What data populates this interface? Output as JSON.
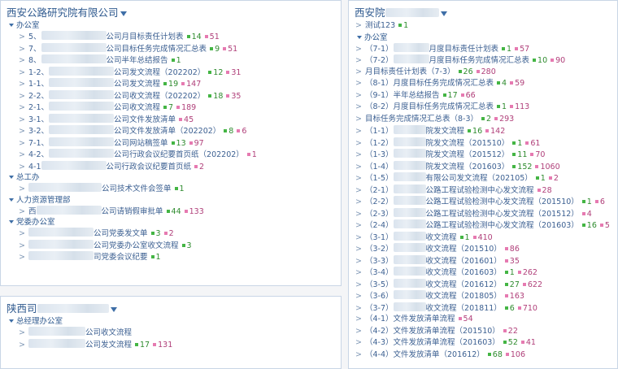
{
  "panels": [
    {
      "title": "西安公路研究院有限公司",
      "sections": [
        {
          "label": "办公室",
          "items": [
            {
              "prefix": "5、",
              "suffix": "公司月目标责任计划表",
              "g": "14",
              "r": "51"
            },
            {
              "prefix": "7、",
              "suffix": "公司目标任务完成情况汇总表",
              "g": "9",
              "r": "51"
            },
            {
              "prefix": "8、",
              "suffix": "公司半年总结报告",
              "g": "1",
              "r": ""
            },
            {
              "prefix": "1-2、",
              "suffix": "公司发文流程（202202）",
              "g": "12",
              "r": "31"
            },
            {
              "prefix": "1-1、",
              "suffix": "公司发文流程",
              "g": "19",
              "r": "147"
            },
            {
              "prefix": "2-2、",
              "suffix": "公司收文流程（202202）",
              "g": "18",
              "r": "35"
            },
            {
              "prefix": "2-1、",
              "suffix": "公司收文流程",
              "g": "7",
              "r": "189"
            },
            {
              "prefix": "3-1、",
              "suffix": "公司文件发放清单",
              "g": "",
              "r": "45"
            },
            {
              "prefix": "3-2、",
              "suffix": "公司文件发放清单（202202）",
              "g": "8",
              "r": "6"
            },
            {
              "prefix": "7-1、",
              "suffix": "公司网站稿签单",
              "g": "13",
              "r": "97"
            },
            {
              "prefix": "4-2、",
              "suffix": "公司行政会议纪要首页纸（202202）",
              "g": "",
              "r": "1"
            },
            {
              "prefix": "4-1",
              "suffix": "公司行政会议纪要首页纸",
              "g": "",
              "r": "2"
            }
          ]
        },
        {
          "label": "总工办",
          "items": [
            {
              "prefix": "",
              "suffix": "公司技术文件会签单",
              "g": "1",
              "r": ""
            }
          ]
        },
        {
          "label": "人力资源管理部",
          "items": [
            {
              "prefix": "西",
              "suffix": "公司请销假审批单",
              "g": "44",
              "r": "133"
            }
          ]
        },
        {
          "label": "党委办公室",
          "items": [
            {
              "prefix": "",
              "suffix": "公司党委发文单",
              "g": "3",
              "r": "2"
            },
            {
              "prefix": "",
              "suffix": "公司党委办公室收文流程",
              "g": "3",
              "r": ""
            },
            {
              "prefix": "",
              "suffix": "司党委会议纪要",
              "g": "1",
              "r": ""
            }
          ]
        }
      ]
    },
    {
      "title": "陕西司",
      "sections": [
        {
          "label": "总经理办公室",
          "items": [
            {
              "prefix": "",
              "suffix": "公司收文流程",
              "g": "",
              "r": ""
            },
            {
              "prefix": "",
              "suffix": "公司发文流程",
              "g": "17",
              "r": "131"
            }
          ]
        }
      ]
    },
    {
      "title": "西安院",
      "top_items": [
        {
          "prefix": "测试123",
          "suffix": "",
          "g": "1",
          "r": ""
        }
      ],
      "sections": [
        {
          "label": "办公室",
          "items": [
            {
              "prefix": "（7-1）",
              "suffix": "月度目标责任计划表",
              "g": "1",
              "r": "57"
            },
            {
              "prefix": "（7-2）",
              "suffix": "月度目标任务完成情况汇总表",
              "g": "10",
              "r": "90"
            },
            {
              "prefix": "月目标责任计划表（7-3）",
              "suffix": "",
              "g": "26",
              "r": "280"
            },
            {
              "prefix": "（8-1）月度目标任务完成情况汇总表",
              "suffix": "",
              "g": "4",
              "r": "59"
            },
            {
              "prefix": "（9-1）半年总结报告",
              "suffix": "",
              "g": "17",
              "r": "66"
            },
            {
              "prefix": "（8-2）月度目标任务完成情况汇总表",
              "suffix": "",
              "g": "1",
              "r": "113"
            },
            {
              "prefix": "目标任务完成情况汇总表（8-3）",
              "suffix": "",
              "g": "2",
              "r": "293"
            },
            {
              "prefix": "（1-1）",
              "suffix": "院发文流程",
              "g": "16",
              "r": "142"
            },
            {
              "prefix": "（1-2）",
              "suffix": "院发文流程（201510）",
              "g": "1",
              "r": "61"
            },
            {
              "prefix": "（1-3）",
              "suffix": "院发文流程（201512）",
              "g": "11",
              "r": "70"
            },
            {
              "prefix": "（1-4）",
              "suffix": "院发文流程（201603）",
              "g": "152",
              "r": "1060"
            },
            {
              "prefix": "（1-5）",
              "suffix": "有限公司发文流程（202105）",
              "g": "1",
              "r": "2"
            },
            {
              "prefix": "（2-1）",
              "suffix": "公路工程试验检测中心发文流程",
              "g": "",
              "r": "28"
            },
            {
              "prefix": "（2-2）",
              "suffix": "公路工程试验检测中心发文流程（201510）",
              "g": "1",
              "r": "6"
            },
            {
              "prefix": "（2-3）",
              "suffix": "公路工程试验检测中心发文流程（201512）",
              "g": "",
              "r": "4"
            },
            {
              "prefix": "（2-4）",
              "suffix": "公路工程试验检测中心发文流程（201603）",
              "g": "16",
              "r": "5"
            },
            {
              "prefix": "（3-1）",
              "suffix": "收文流程",
              "g": "1",
              "r": "410"
            },
            {
              "prefix": "（3-2）",
              "suffix": "收文流程（201510）",
              "g": "",
              "r": "86"
            },
            {
              "prefix": "（3-3）",
              "suffix": "收文流程（201601）",
              "g": "",
              "r": "35"
            },
            {
              "prefix": "（3-4）",
              "suffix": "收文流程（201603）",
              "g": "1",
              "r": "262"
            },
            {
              "prefix": "（3-5）",
              "suffix": "收文流程（201612）",
              "g": "27",
              "r": "622"
            },
            {
              "prefix": "（3-6）",
              "suffix": "收文流程（201805）",
              "g": "",
              "r": "163"
            },
            {
              "prefix": "（3-7）",
              "suffix": "收文流程（201811）",
              "g": "6",
              "r": "710"
            },
            {
              "prefix": "（4-1）文件发放清单流程",
              "suffix": "",
              "g": "",
              "r": "54"
            },
            {
              "prefix": "（4-2）文件发放清单流程（201510）",
              "suffix": "",
              "g": "",
              "r": "22"
            },
            {
              "prefix": "（4-3）文件发放清单流程（201603）",
              "suffix": "",
              "g": "52",
              "r": "41"
            },
            {
              "prefix": "（4-4）文件发放清单（201612）",
              "suffix": "",
              "g": "68",
              "r": "106"
            }
          ]
        }
      ]
    }
  ],
  "colors": {
    "link": "#3b5f91",
    "green": "#44b544",
    "red": "#e67ab1"
  }
}
